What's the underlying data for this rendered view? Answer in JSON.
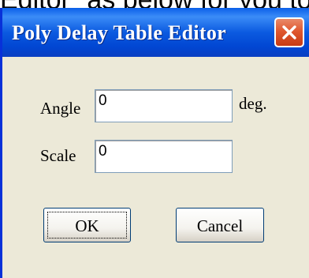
{
  "background_text": "Editor\" as below for you to",
  "window": {
    "title": "Poly Delay Table Editor"
  },
  "fields": {
    "angle": {
      "label": "Angle",
      "value": "0",
      "unit": "deg."
    },
    "scale": {
      "label": "Scale",
      "value": "0"
    }
  },
  "buttons": {
    "ok": "OK",
    "cancel": "Cancel"
  },
  "colors": {
    "titlebar": "#0b5ae0",
    "dialog_bg": "#ece9d8",
    "close_button": "#e0582f"
  },
  "icons": {
    "close": "close-icon"
  }
}
